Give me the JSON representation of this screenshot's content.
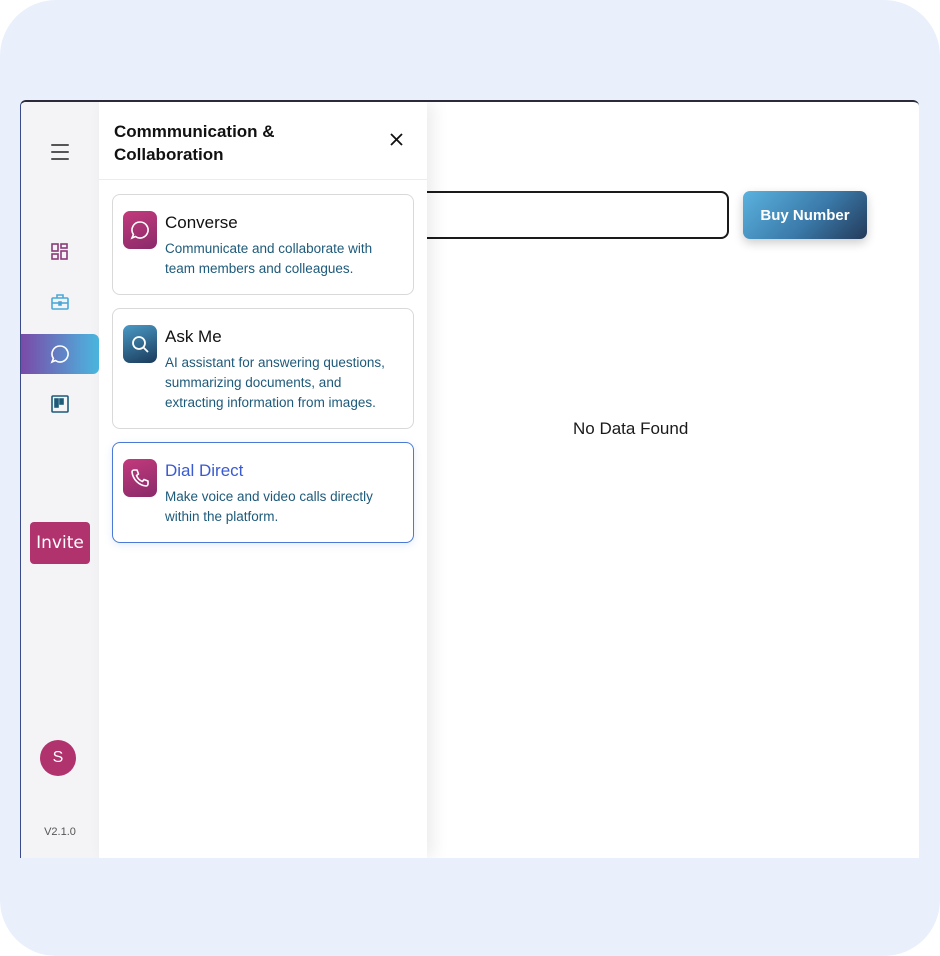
{
  "rail": {
    "version": "V2.1.0",
    "invite_label": "Invite",
    "avatar_initial": "S",
    "items": [
      {
        "icon": "dashboard-icon"
      },
      {
        "icon": "briefcase-icon"
      },
      {
        "icon": "chat-icon",
        "active": true
      },
      {
        "icon": "board-icon"
      }
    ]
  },
  "panel": {
    "title": "Commmunication & Collaboration",
    "cards": [
      {
        "title": "Converse",
        "description": "Communicate and collaborate with team members and colleagues.",
        "icon": "chat-icon"
      },
      {
        "title": "Ask Me",
        "description": "AI assistant for answering questions, summarizing documents, and extracting information from images.",
        "icon": "search-icon"
      },
      {
        "title": "Dial Direct",
        "description": "Make voice and video calls directly within the platform.",
        "icon": "phone-icon",
        "selected": true
      }
    ]
  },
  "main": {
    "buy_button": "Buy Number",
    "empty_message": "No Data Found"
  },
  "colors": {
    "accent_pink": "#b0336e",
    "selected_border": "#4a7ad6",
    "description_text": "#1d5a7a"
  }
}
